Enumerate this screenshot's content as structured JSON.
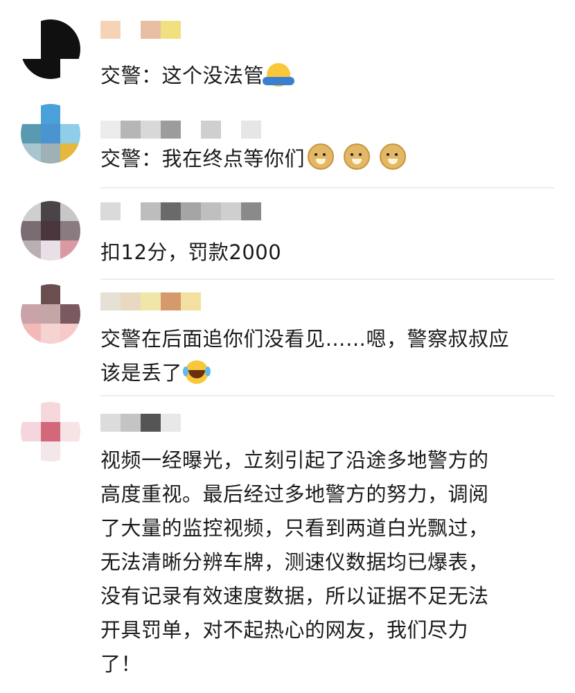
{
  "comments": [
    {
      "id": "c1",
      "avatar_colors": [
        "#ffffff",
        "#101010",
        "#101010",
        "#ffffff",
        "#101010",
        "#101010",
        "#101010",
        "#101010",
        "#ffffff"
      ],
      "name_blur_colors": [
        "#f5d4b6",
        "#ffffff",
        "#e8bfa4",
        "#f0e080"
      ],
      "text": "交警：这个没法管",
      "emoji": "shrug-emoji"
    },
    {
      "id": "c2",
      "avatar_colors": [
        "#ffffff",
        "#4aa0d8",
        "#ffffff",
        "#5a9ab0",
        "#4a94cf",
        "#8fcde8",
        "#a9c5cf",
        "#9fb1b5",
        "#e4b83c"
      ],
      "name_blur_colors": [
        "#ececec",
        "#b6b6b6",
        "#d8d8d8",
        "#9c9c9c",
        "#ffffff",
        "#cfcfcf",
        "#ffffff",
        "#e6e6e6"
      ],
      "text": "交警：我在终点等你们",
      "emoji": "doge-emoji"
    },
    {
      "id": "c3",
      "avatar_colors": [
        "#cfcfcf",
        "#4a4347",
        "#c7c7c7",
        "#7b6b72",
        "#4b363d",
        "#8a7b80",
        "#b9b0b4",
        "#e8e0e6",
        "#d99aa4"
      ],
      "name_blur_colors": [
        "#dadada",
        "#ffffff",
        "#bdbdbd",
        "#6a6a6a",
        "#a5a5a5",
        "#bfbfbf",
        "#cfcfcf",
        "#8a8a8a"
      ],
      "text": "扣12分，罚款2000"
    },
    {
      "id": "c4",
      "avatar_colors": [
        "#ffffff",
        "#6b4f4f",
        "#ffffff",
        "#c9a3a7",
        "#c5a6a6",
        "#7a5a60",
        "#f3b9b9",
        "#f5d3d0",
        "#f7c9c9"
      ],
      "name_blur_colors": [
        "#e6e0d6",
        "#e8d9c0",
        "#f0e6a8",
        "#d49a6c",
        "#f3e0a0"
      ],
      "text_line1": "交警在后面追你们没看见……嗯，警察叔叔应",
      "text_line2": "该是丢了",
      "emoji": "laughing-emoji"
    },
    {
      "id": "c5",
      "avatar_colors": [
        "#ffffff",
        "#f6d7dc",
        "#ffffff",
        "#f4d6dc",
        "#d2687a",
        "#f5e3e6",
        "#ffffff",
        "#f3e7ea",
        "#ffffff"
      ],
      "name_blur_colors": [
        "#dcdcdc",
        "#c4c4c4",
        "#555555",
        "#e8e8e8",
        "#ffffff"
      ],
      "text_lines": [
        "视频一经曝光，立刻引起了沿途多地警方的",
        "高度重视。最后经过多地警方的努力，调阅",
        "了大量的监控视频，只看到两道白光飘过，",
        "无法清晰分辨车牌，测速仪数据均已爆表，",
        "没有记录有效速度数据，所以证据不足无法",
        "开具罚单，对不起热心的网友，我们尽力",
        "了！"
      ]
    }
  ]
}
